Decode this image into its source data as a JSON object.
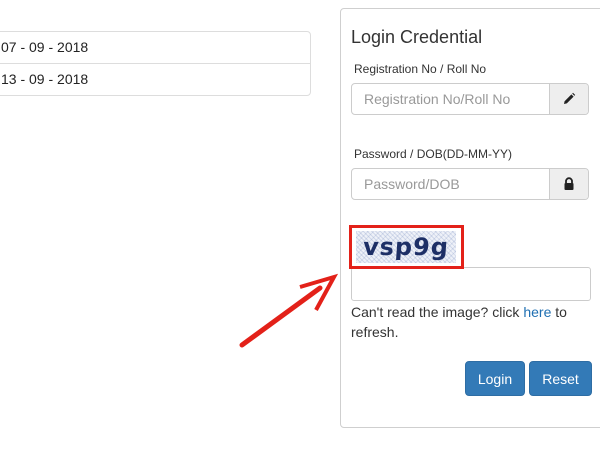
{
  "dates": [
    "07 - 09 - 2018",
    "13 - 09 - 2018"
  ],
  "login": {
    "title": "Login Credential",
    "reg_label": "Registration No / Roll No",
    "reg_placeholder": "Registration No/Roll No",
    "pwd_label": "Password / DOB(DD-MM-YY)",
    "pwd_placeholder": "Password/DOB",
    "captcha_text": "vsp9g",
    "refresh_prefix": "Can't read the image? click ",
    "refresh_link": "here",
    "refresh_suffix": " to refresh.",
    "login_button": "Login",
    "reset_button": "Reset"
  },
  "colors": {
    "primary": "#337ab7",
    "highlight_red": "#e32119",
    "link": "#1f6fb2"
  },
  "icons": [
    "pencil-icon",
    "lock-icon",
    "red-arrow-annotation"
  ]
}
